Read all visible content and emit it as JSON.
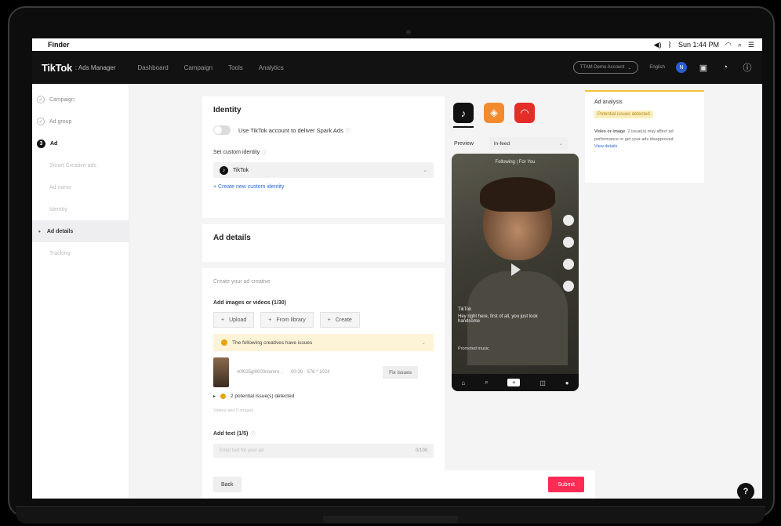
{
  "menubar": {
    "apple": "",
    "app_name": "Finder",
    "clock": "Sun 1:44 PM"
  },
  "topbar": {
    "logo": "TikTok",
    "logo_sub": ": Ads Manager",
    "nav": [
      "Dashboard",
      "Campaign",
      "Tools",
      "Analytics"
    ],
    "account": "TTAM Demo Account",
    "language": "English",
    "avatar_initial": "N"
  },
  "sidebar": {
    "items": [
      {
        "label": "Campaign"
      },
      {
        "label": "Ad group"
      },
      {
        "label": "Ad",
        "step": "3"
      },
      {
        "label": "Smart Creative ads"
      },
      {
        "label": "Ad name"
      },
      {
        "label": "Identity"
      },
      {
        "label": "Ad details"
      },
      {
        "label": "Tracking"
      }
    ]
  },
  "identity": {
    "title": "Identity",
    "spark_toggle_label": "Use TikTok account to deliver Spark Ads",
    "custom_label": "Set custom identity",
    "selected_identity": "TikTok",
    "create_link": "+ Create new custom identity"
  },
  "ad_details": {
    "title": "Ad details"
  },
  "creative": {
    "heading": "Create your ad creative",
    "add_media_label": "Add images or videos (1/30)",
    "upload": "Upload",
    "from_library": "From library",
    "create": "Create",
    "warning": "The following creatives have issues",
    "file_name": "v0f025gl0000ctomm...",
    "file_meta": "00:30 · 576 * 1024",
    "fix_issues": "Fix issues",
    "issues_detected": "2 potential issue(s) detected",
    "footer_note": "Videos and 0 images",
    "add_text_label": "Add text (1/5)",
    "text_placeholder": "Enter text for your ad",
    "text_count": "0/100"
  },
  "actions": {
    "back": "Back",
    "submit": "Submit"
  },
  "preview": {
    "label": "Preview",
    "placement": "In-feed",
    "top_text": "Following  |  For You",
    "caption": "Hey right here, first of all, you just look handsome",
    "account": "TikTok",
    "promoted": "Promoted music"
  },
  "analysis": {
    "title": "Ad analysis",
    "badge": "Potential issues detected",
    "body_bold": "Video or image",
    "body": ": 2 issue(s) may affect ad performance or get your ads disapproved.",
    "link": "View details"
  },
  "help": "?",
  "colors": {
    "accent": "#fe2c55",
    "link": "#2a67d6",
    "warning": "#e5a50a"
  }
}
